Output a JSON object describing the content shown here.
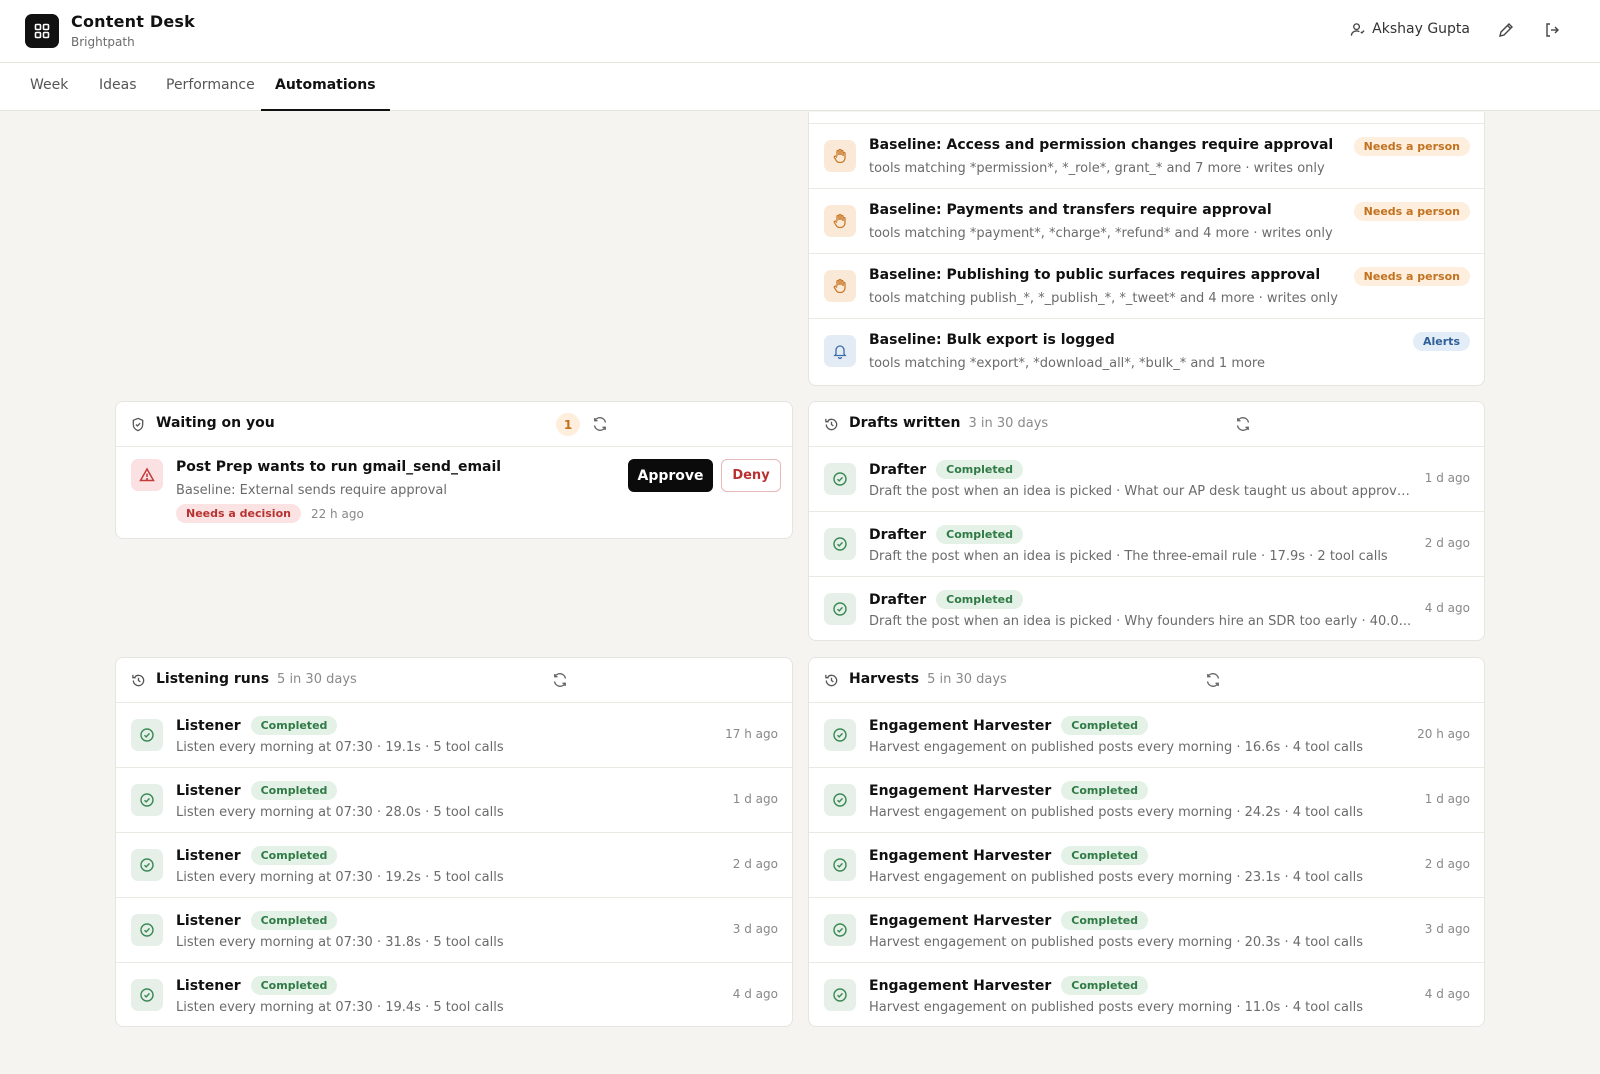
{
  "app": {
    "title": "Content Desk",
    "workspace": "Brightpath"
  },
  "user": {
    "name": "Akshay Gupta"
  },
  "tabs": [
    {
      "label": "Week"
    },
    {
      "label": "Ideas"
    },
    {
      "label": "Performance"
    },
    {
      "label": "Automations"
    }
  ],
  "active_tab": "Automations",
  "policies": [
    {
      "title": "Baseline: Access and permission changes require approval",
      "detail": "tools matching *permission*, *_role*, grant_* and 7 more · writes only",
      "badge": "Needs a person",
      "icon": "hand-icon"
    },
    {
      "title": "Baseline: Payments and transfers require approval",
      "detail": "tools matching *payment*, *charge*, *refund* and 4 more · writes only",
      "badge": "Needs a person",
      "icon": "hand-icon"
    },
    {
      "title": "Baseline: Publishing to public surfaces requires approval",
      "detail": "tools matching publish_*, *_publish_*, *_tweet* and 4 more · writes only",
      "badge": "Needs a person",
      "icon": "hand-icon"
    },
    {
      "title": "Baseline: Bulk export is logged",
      "detail": "tools matching *export*, *download_all*, *bulk_* and 1 more",
      "badge": "Alerts",
      "icon": "bell-icon"
    }
  ],
  "waiting": {
    "title": "Waiting on you",
    "count": "1",
    "items": [
      {
        "title": "Post Prep wants to run gmail_send_email",
        "detail": "Baseline: External sends require approval",
        "badge": "Needs a decision",
        "time": "22 h ago",
        "approve_label": "Approve",
        "deny_label": "Deny"
      }
    ]
  },
  "drafts": {
    "title": "Drafts written",
    "meta": "3 in 30 days",
    "items": [
      {
        "name": "Drafter",
        "status": "Completed",
        "detail": "Draft the post when an idea is picked · What our AP desk taught us about approva...",
        "time": "1 d ago"
      },
      {
        "name": "Drafter",
        "status": "Completed",
        "detail": "Draft the post when an idea is picked · The three-email rule · 17.9s · 2 tool calls",
        "time": "2 d ago"
      },
      {
        "name": "Drafter",
        "status": "Completed",
        "detail": "Draft the post when an idea is picked · Why founders hire an SDR too early · 40.0...",
        "time": "4 d ago"
      }
    ]
  },
  "listening": {
    "title": "Listening runs",
    "meta": "5 in 30 days",
    "items": [
      {
        "name": "Listener",
        "status": "Completed",
        "detail": "Listen every morning at 07:30 · 19.1s · 5 tool calls",
        "time": "17 h ago"
      },
      {
        "name": "Listener",
        "status": "Completed",
        "detail": "Listen every morning at 07:30 · 28.0s · 5 tool calls",
        "time": "1 d ago"
      },
      {
        "name": "Listener",
        "status": "Completed",
        "detail": "Listen every morning at 07:30 · 19.2s · 5 tool calls",
        "time": "2 d ago"
      },
      {
        "name": "Listener",
        "status": "Completed",
        "detail": "Listen every morning at 07:30 · 31.8s · 5 tool calls",
        "time": "3 d ago"
      },
      {
        "name": "Listener",
        "status": "Completed",
        "detail": "Listen every morning at 07:30 · 19.4s · 5 tool calls",
        "time": "4 d ago"
      }
    ]
  },
  "harvests": {
    "title": "Harvests",
    "meta": "5 in 30 days",
    "items": [
      {
        "name": "Engagement Harvester",
        "status": "Completed",
        "detail": "Harvest engagement on published posts every morning · 16.6s · 4 tool calls",
        "time": "20 h ago"
      },
      {
        "name": "Engagement Harvester",
        "status": "Completed",
        "detail": "Harvest engagement on published posts every morning · 24.2s · 4 tool calls",
        "time": "1 d ago"
      },
      {
        "name": "Engagement Harvester",
        "status": "Completed",
        "detail": "Harvest engagement on published posts every morning · 23.1s · 4 tool calls",
        "time": "2 d ago"
      },
      {
        "name": "Engagement Harvester",
        "status": "Completed",
        "detail": "Harvest engagement on published posts every morning · 20.3s · 4 tool calls",
        "time": "3 d ago"
      },
      {
        "name": "Engagement Harvester",
        "status": "Completed",
        "detail": "Harvest engagement on published posts every morning · 11.0s · 4 tool calls",
        "time": "4 d ago"
      }
    ]
  }
}
